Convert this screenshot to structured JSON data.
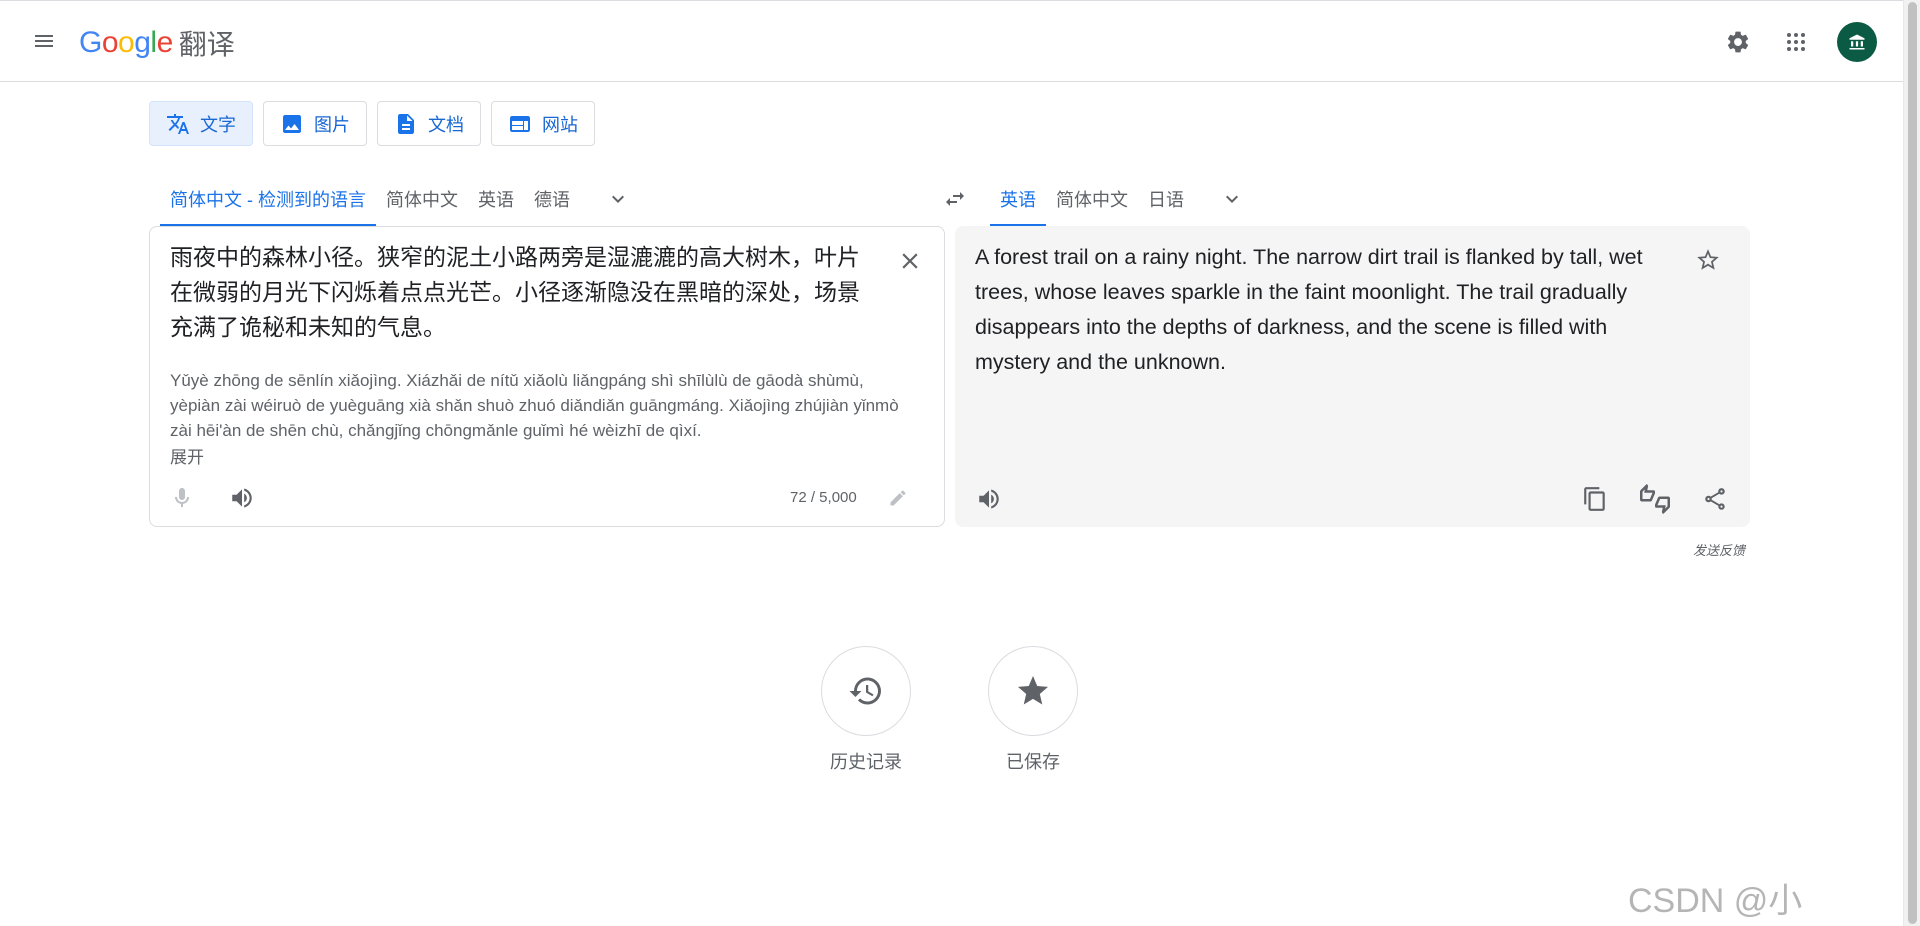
{
  "header": {
    "logo_letters": [
      "G",
      "o",
      "o",
      "g",
      "l",
      "e"
    ],
    "logo_colors": [
      "#4285f4",
      "#ea4335",
      "#fbbc05",
      "#4285f4",
      "#34a853",
      "#ea4335"
    ],
    "product_name": "翻译",
    "avatar_initial": "🏛"
  },
  "modes": [
    {
      "label": "文字",
      "icon": "translate-icon",
      "active": true
    },
    {
      "label": "图片",
      "icon": "image-icon",
      "active": false
    },
    {
      "label": "文档",
      "icon": "document-icon",
      "active": false
    },
    {
      "label": "网站",
      "icon": "website-icon",
      "active": false
    }
  ],
  "source_langs": [
    {
      "label": "简体中文 - 检测到的语言",
      "active": true
    },
    {
      "label": "简体中文",
      "active": false
    },
    {
      "label": "英语",
      "active": false
    },
    {
      "label": "德语",
      "active": false
    }
  ],
  "target_langs": [
    {
      "label": "英语",
      "active": true
    },
    {
      "label": "简体中文",
      "active": false
    },
    {
      "label": "日语",
      "active": false
    }
  ],
  "source": {
    "text": "雨夜中的森林小径。狭窄的泥土小路两旁是湿漉漉的高大树木，叶片在微弱的月光下闪烁着点点光芒。小径逐渐隐没在黑暗的深处，场景充满了诡秘和未知的气息。",
    "transliteration": "Yǔyè zhōng de sēnlín xiǎojìng. Xiázhǎi de nítǔ xiǎolù liǎngpáng shì shīlùlù de gāodà shùmù, yèpiàn zài wéiruò de yuèguāng xià shǎn shuò zhuó diǎndiǎn guāngmáng. Xiǎojìng zhújiàn yǐnmò zài hēi'àn de shēn chù, chǎngjǐng chōngmǎnle guǐmì hé wèizhī de qìxí.",
    "expand_label": "展开",
    "char_count": "72 / 5,000"
  },
  "target": {
    "text": "A forest trail on a rainy night. The narrow dirt trail is flanked by tall, wet trees, whose leaves sparkle in the faint moonlight. The trail gradually disappears into the depths of darkness, and the scene is filled with mystery and the unknown."
  },
  "feedback_label": "发送反馈",
  "bottom": {
    "history_label": "历史记录",
    "saved_label": "已保存"
  },
  "watermark": "CSDN @小"
}
